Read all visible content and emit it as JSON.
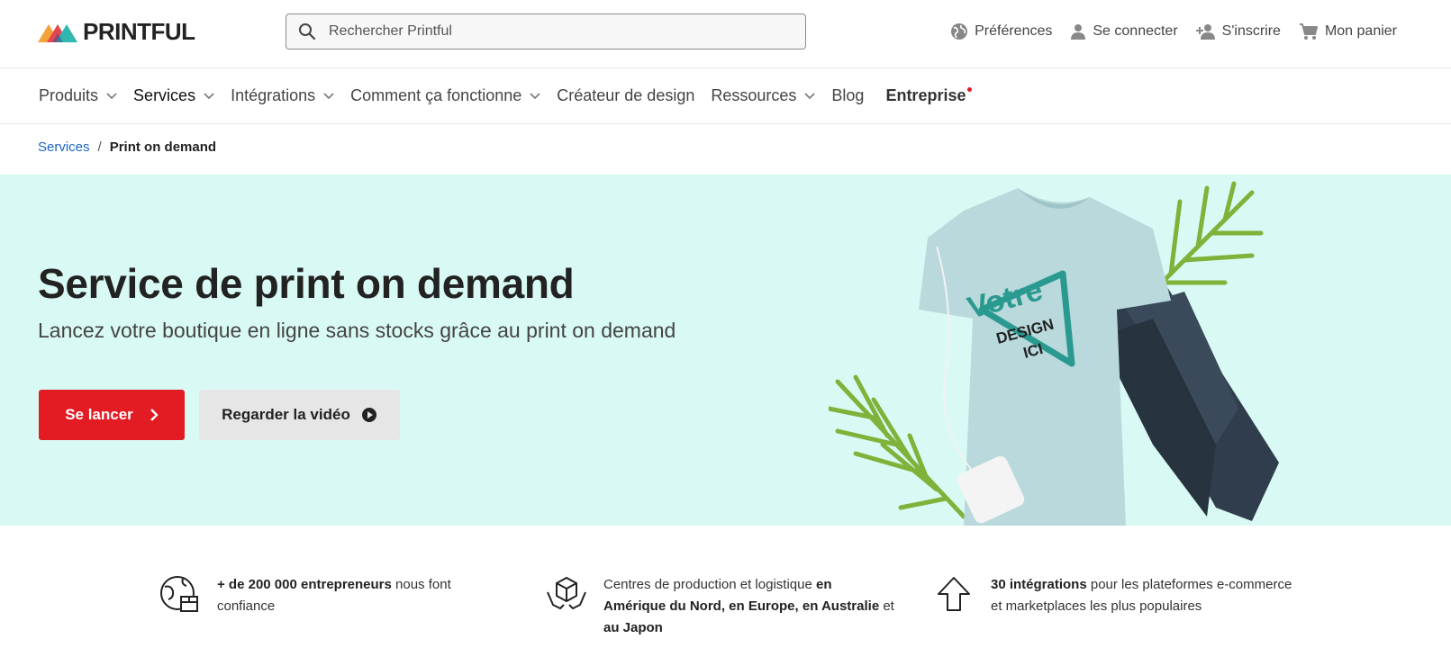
{
  "header": {
    "logo_text": "PRINTFUL",
    "search_placeholder": "Rechercher Printful",
    "links": {
      "preferences": "Préférences",
      "login": "Se connecter",
      "signup": "S'inscrire",
      "cart": "Mon panier"
    }
  },
  "nav": {
    "items": [
      {
        "label": "Produits"
      },
      {
        "label": "Services"
      },
      {
        "label": "Intégrations"
      },
      {
        "label": "Comment ça fonctionne"
      },
      {
        "label": "Créateur de design"
      },
      {
        "label": "Ressources"
      },
      {
        "label": "Blog"
      },
      {
        "label": "Entreprise"
      }
    ]
  },
  "breadcrumb": {
    "parent": "Services",
    "separator": "/",
    "current": "Print on demand"
  },
  "hero": {
    "title": "Service de print on demand",
    "subtitle": "Lancez votre boutique en ligne sans stocks grâce au print on demand",
    "primary_button": "Se lancer",
    "secondary_button": "Regarder la vidéo",
    "shirt_text_1": "Votre",
    "shirt_text_2": "DESIGN",
    "shirt_text_3": "ICI",
    "background_color": "#d9faf4",
    "accent_color": "#e31b23"
  },
  "features": [
    {
      "icon": "globe-box-icon",
      "bold_1": "+ de 200 000 entrepreneurs",
      "text_1": " nous font confiance"
    },
    {
      "icon": "package-hands-icon",
      "text_1": "Centres de production et logistique ",
      "bold_1": "en Amérique du Nord, en Europe, en Australie",
      "text_2": " et ",
      "bold_2": "au Japon"
    },
    {
      "icon": "arrow-up-icon",
      "bold_1": "30 intégrations",
      "text_1": " pour les plateformes e-commerce et marketplaces les plus populaires"
    }
  ]
}
